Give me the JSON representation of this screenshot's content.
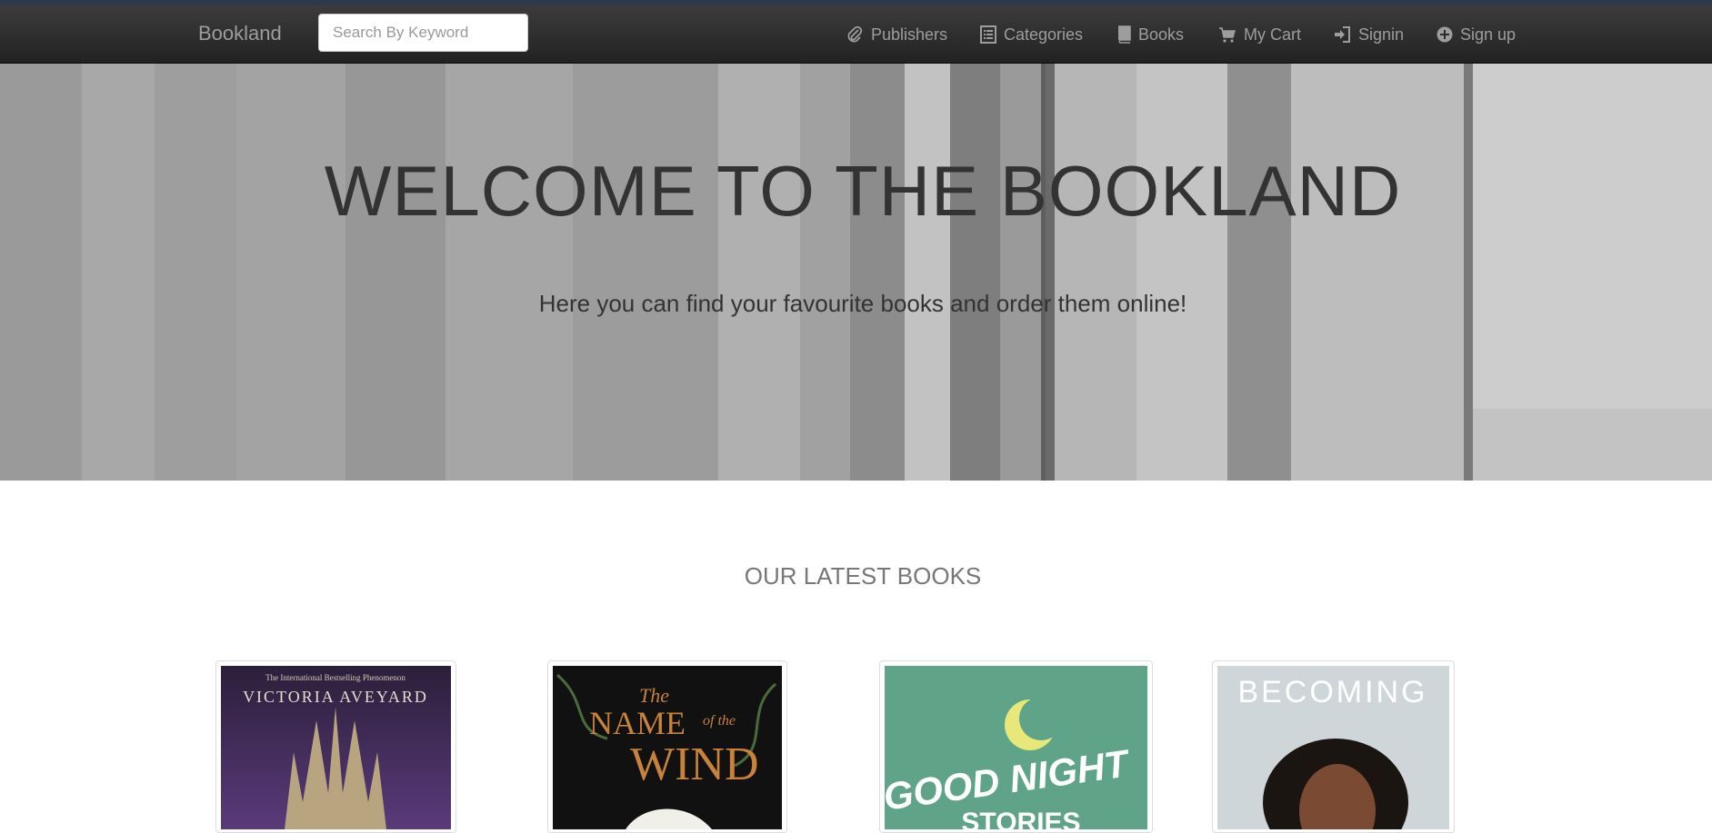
{
  "navbar": {
    "brand": "Bookland",
    "search_placeholder": "Search By Keyword",
    "items": [
      {
        "label": "Publishers",
        "icon": "paperclip-icon"
      },
      {
        "label": "Categories",
        "icon": "list-icon"
      },
      {
        "label": "Books",
        "icon": "book-icon"
      },
      {
        "label": "My Cart",
        "icon": "cart-icon"
      },
      {
        "label": "Signin",
        "icon": "log-in-icon"
      },
      {
        "label": "Sign up",
        "icon": "plus-circle-icon"
      }
    ]
  },
  "hero": {
    "title": "WELCOME TO THE BOOKLAND",
    "subtitle": "Here you can find your favourite books and order them online!"
  },
  "latest": {
    "title": "OUR LATEST BOOKS",
    "books": [
      {
        "cover_text_1": "The International Bestselling Phenomenon",
        "cover_text_2": "VICTORIA AVEYARD"
      },
      {
        "cover_text_1": "The",
        "cover_text_2": "NAME",
        "cover_text_3": "of the",
        "cover_text_4": "WIND"
      },
      {
        "cover_text_1": "GOOD NIGHT",
        "cover_text_2": "STORIES"
      },
      {
        "cover_text_1": "BECOMING"
      }
    ]
  },
  "colors": {
    "navbar": "#222222",
    "nav_text": "#9d9d9d",
    "hero_text": "#333333",
    "section_title": "#777777"
  }
}
